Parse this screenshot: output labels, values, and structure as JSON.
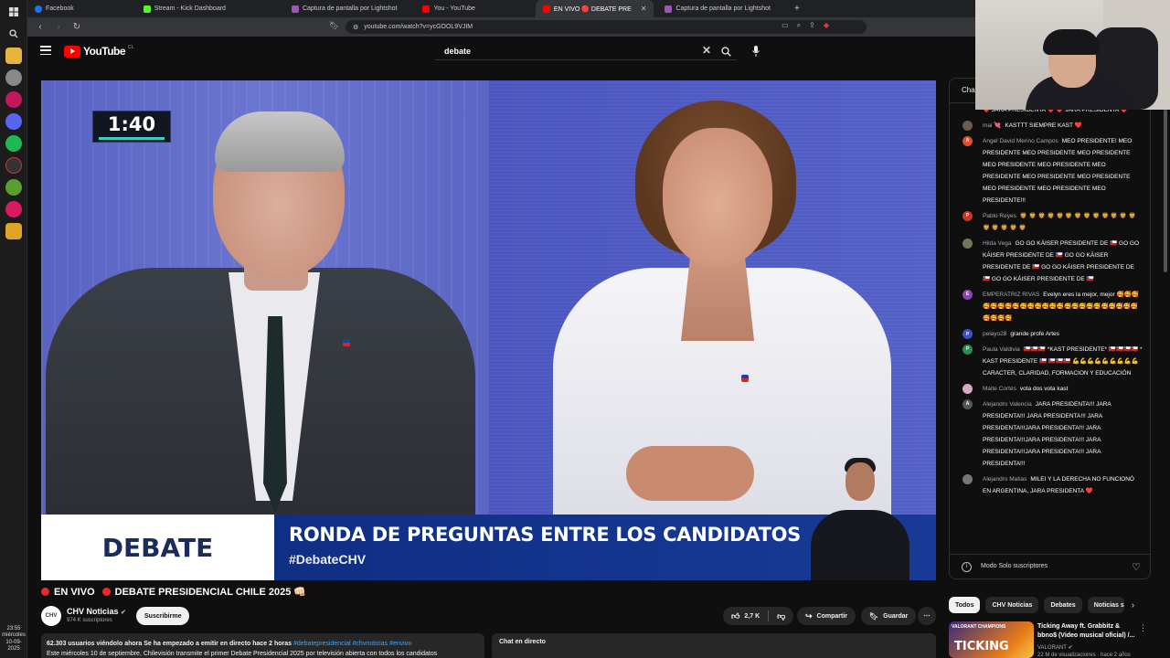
{
  "browser": {
    "tabs": [
      {
        "label": "Facebook",
        "color": "#1877f2"
      },
      {
        "label": "Stream - Kick Dashboard",
        "color": "#53fc18"
      },
      {
        "label": "Captura de pantalla por Lightshot",
        "color": "#9b59b6"
      },
      {
        "label": "You - YouTube",
        "color": "#ff0000"
      },
      {
        "label": "EN VIVO 🔴 DEBATE PRE",
        "color": "#ff0000",
        "active": true
      },
      {
        "label": "Captura de pantalla por Lightshot",
        "color": "#9b59b6"
      }
    ],
    "new_tab": "+",
    "url": "youtube.com/watch?v=ycGOOL9VJIM"
  },
  "youtube": {
    "logo_text": "YouTube",
    "country_code": "CL",
    "search_value": "debate"
  },
  "player": {
    "timer": "1:40",
    "lower_third_brand": "DEBATE",
    "lower_third_title": "RONDA DE PREGUNTAS ENTRE LOS CANDIDATOS",
    "lower_third_hashtag": "#DebateCHV"
  },
  "video": {
    "live_label": "EN VIVO",
    "title": "DEBATE PRESIDENCIAL CHILE 2025 👊🏻",
    "channel_name": "CHV Noticias",
    "channel_avatar": "CHV",
    "subscribers": "974 K suscriptores",
    "subscribe_label": "Suscribirme",
    "likes": "2,7 K",
    "share_label": "Compartir",
    "save_label": "Guardar",
    "more_label": "⋯",
    "description_stats": "62.303 usuarios viéndolo ahora  Se ha empezado a emitir en directo hace 2 horas",
    "description_tags": "#debatepresidencial #chvnoticias #envivo",
    "description_text": "Este miércoles 10 de septiembre, Chilevisión transmite el primer Debate Presidencial 2025 por televisión abierta con todos los candidatos",
    "chat_direct_label": "Chat en directo"
  },
  "chat": {
    "header": "Cha",
    "messages": [
      {
        "author": "",
        "text": "❤️ JARA PRESIDENTA ❤️ ❤️ JARA PRESIDENTA ❤️",
        "avatar_color": "transparent",
        "initial": ""
      },
      {
        "author": "mai 💘",
        "text": "KASTTT SIEMPRE KAST ❤️",
        "avatar_color": "#6b5a4e",
        "initial": ""
      },
      {
        "author": "Angel David Merino Campos",
        "text": "MEO PRESIDENTE! MEO PRESIDENTE MEO PRESIDENTE MEO PRESIDENTE MEO PRESIDENTE MEO PRESIDENTE MEO PRESIDENTE MEO PRESIDENTE MEO PRESIDENTE MEO PRESIDENTE MEO PRESIDENTE MEO PRESIDENTE!!!",
        "avatar_color": "#e0502b",
        "initial": "A"
      },
      {
        "author": "Pablo Reyes",
        "text": "🦁 🦁 🦁 🦁 🦁 🦁 🦁 🦁 🦁 🦁 🦁 🦁 🦁 🦁 🦁 🦁 🦁 🦁",
        "avatar_color": "#c0392b",
        "initial": "P"
      },
      {
        "author": "Hilda Vega",
        "text": "GO GO KÁISER PRESIDENTE DE 🇨🇱 GO GO KÁISER PRESIDENTE DE 🇨🇱 GO GO KÁISER PRESIDENTE DE 🇨🇱 GO GO KÁISER PRESIDENTE DE 🇨🇱 GO GO KÁISER PRESIDENTE DE 🇨🇱",
        "avatar_color": "#6d7a55",
        "initial": ""
      },
      {
        "author": "EMPERATRIZ RIVAS",
        "text": "Evelyn eres la mejor, mejor 🥰🥰🥰🥰🥰🥰🥰🥰🥰🥰🥰🥰🥰🥰🥰🥰🥰🥰🥰🥰🥰🥰🥰🥰🥰🥰🥰🥰",
        "avatar_color": "#8e44ad",
        "initial": "E"
      },
      {
        "author": "pelayo28",
        "text": "grande profe Artes",
        "avatar_color": "#3f51b5",
        "initial": "p"
      },
      {
        "author": "Paula Valdivia",
        "text": "🇨🇱🇨🇱🇨🇱 *KAST PRESIDENTE* 🇨🇱🇨🇱🇨🇱🇨🇱 * KAST PRESIDENTE 🇨🇱 🇨🇱🇨🇱🇨🇱 💪💪💪💪💪💪💪💪💪 CARACTER, CLARIDAD, FORMACION Y EDUCACIÓN",
        "avatar_color": "#2e8b57",
        "initial": "P"
      },
      {
        "author": "Maite Cortés",
        "text": "vota dos vota kast",
        "avatar_color": "#d8a8c8",
        "initial": ""
      },
      {
        "author": "Alejandro Valencia",
        "text": "JARA PRESIDENTA!!! JARA PRESIDENTA!!! JARA PRESIDENTA!!! JARA PRESIDENTA!!!JARA PRESIDENTA!!! JARA PRESIDENTA!!!JARA PRESIDENTA!!! JARA PRESIDENTA!!!JARA PRESIDENTA!!! JARA PRESIDENTA!!!",
        "avatar_color": "#555555",
        "initial": "A"
      },
      {
        "author": "Alejandro Matias",
        "text": "MILEI Y LA DERECHA NO FUNCIONÓ EN ARGENTINA, JARA PRESIDENTA ❤️",
        "avatar_color": "#777777",
        "initial": ""
      }
    ],
    "footer_mode": "Modo Solo suscriptores"
  },
  "chips": [
    "Todos",
    "CHV Noticias",
    "Debates",
    "Noticias su"
  ],
  "recommendation": {
    "thumb_badge": "VALORANT CHAMPIONS",
    "thumb_text": "TICKING",
    "title": "Ticking Away ft. Grabbitz & bbno$ (Video musical oficial) /...",
    "channel": "VALORANT",
    "meta": "22 M de visualizaciones · hace 2 años"
  },
  "taskbar": {
    "time": "23:55",
    "day": "miércoles",
    "date": "10-09-2025"
  }
}
